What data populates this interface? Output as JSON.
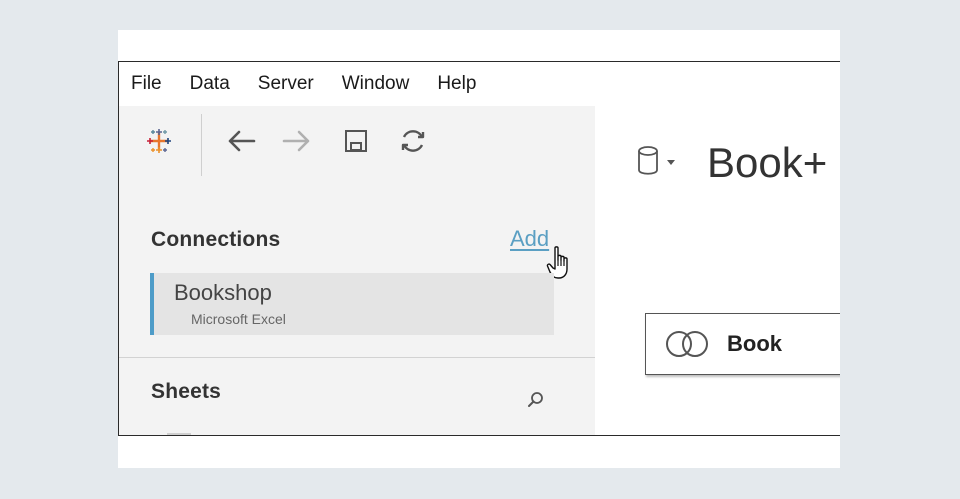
{
  "menu": [
    "File",
    "Data",
    "Server",
    "Window",
    "Help"
  ],
  "toolbar": {
    "icons": [
      "tableau-logo-icon",
      "back-arrow-icon",
      "forward-arrow-icon",
      "save-icon",
      "refresh-icon"
    ]
  },
  "connections": {
    "title": "Connections",
    "add_label": "Add",
    "items": [
      {
        "name": "Bookshop",
        "type": "Microsoft Excel"
      }
    ]
  },
  "sheets": {
    "title": "Sheets"
  },
  "canvas": {
    "datasource_title": "Book+",
    "table_pill": "Book"
  },
  "colors": {
    "accent": "#4e9cc8",
    "link": "#5a9fc3",
    "pane_bg": "#f3f3f3",
    "page_bg": "#e4e9ed"
  }
}
